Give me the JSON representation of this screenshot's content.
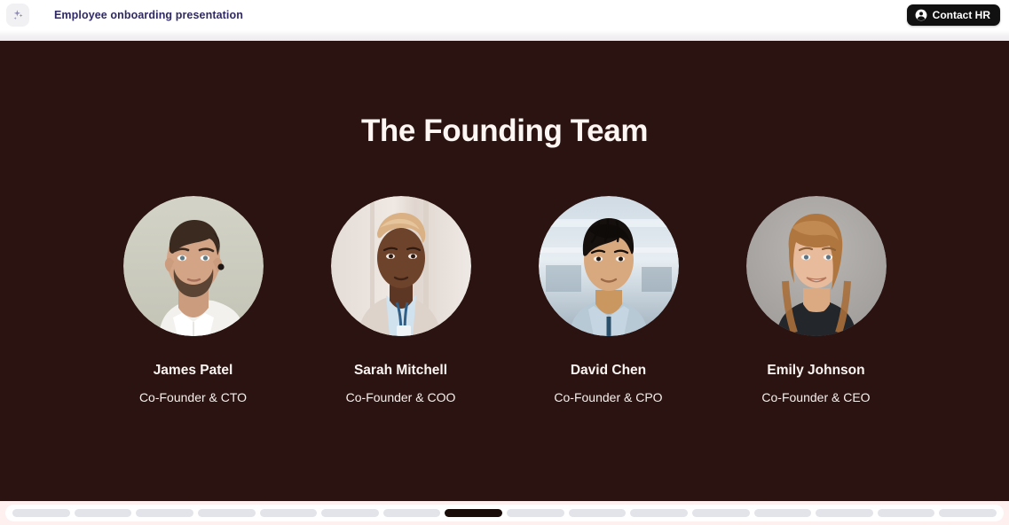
{
  "topbar": {
    "logo_icon": "sparkles-icon",
    "doc_title": "Employee onboarding presentation",
    "contact_button": {
      "label": "Contact HR",
      "icon": "account-circle-icon",
      "bg": "#111111",
      "fg": "#ffffff"
    }
  },
  "slide": {
    "background": "#2a1310",
    "title": "The Founding Team",
    "title_color": "#fdf6f3",
    "members": [
      {
        "name": "James Patel",
        "role": "Co-Founder & CTO",
        "photo_description": "bearded man in white shirt on sage background",
        "photo_bg": "#ccccc0",
        "skin": "#d4a486",
        "hair": "#3a2a20",
        "clothes": "#f2f0ec"
      },
      {
        "name": "Sarah Mitchell",
        "role": "Co-Founder & COO",
        "photo_description": "woman with short blonde hair in light blazer",
        "photo_bg": "#e9e1dc",
        "skin": "#6e432c",
        "hair": "#d9b184",
        "clothes": "#ded3cc"
      },
      {
        "name": "David Chen",
        "role": "Co-Founder & CPO",
        "photo_description": "man in denim shirt in bright office",
        "photo_bg": "#b9c7d2",
        "skin": "#d8a97f",
        "hair": "#15100d",
        "clothes": "#b8c9d6"
      },
      {
        "name": "Emily Johnson",
        "role": "Co-Founder & CEO",
        "photo_description": "smiling woman with long auburn hair on gray background",
        "photo_bg": "#a9a5a2",
        "skin": "#e7bb9c",
        "hair": "#b0763f",
        "clothes": "#23262b"
      }
    ]
  },
  "slidestrip": {
    "total_slides": 16,
    "active_slide": 8,
    "active_color": "#1a0c09",
    "inactive_color": "#e2e4e9",
    "background": "#fdf0ee"
  }
}
